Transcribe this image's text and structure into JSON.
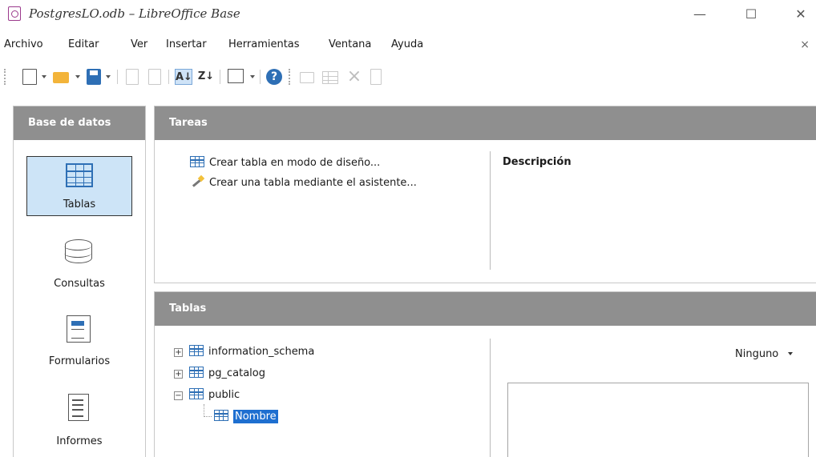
{
  "window": {
    "title": "PostgresLO.odb – LibreOffice Base",
    "minimize": "—",
    "maximize": "☐",
    "close": "✕"
  },
  "menubar": {
    "items": [
      "Archivo",
      "Editar",
      "Ver",
      "Insertar",
      "Herramientas",
      "Ventana",
      "Ayuda"
    ],
    "close": "×"
  },
  "toolbar": {
    "sort_asc": "A↓",
    "sort_desc": "Z↓",
    "help": "?"
  },
  "left_panel": {
    "header": "Base de datos",
    "items": [
      {
        "label": "Tablas",
        "active": true,
        "icon": "table-icon"
      },
      {
        "label": "Consultas",
        "active": false,
        "icon": "database-icon"
      },
      {
        "label": "Formularios",
        "active": false,
        "icon": "form-icon"
      },
      {
        "label": "Informes",
        "active": false,
        "icon": "report-icon"
      }
    ]
  },
  "tasks_panel": {
    "header": "Tareas",
    "tasks": [
      {
        "label": "Crear tabla en modo de diseño...",
        "icon": "table-design-icon"
      },
      {
        "label": "Crear una tabla mediante el asistente...",
        "icon": "wizard-icon"
      }
    ],
    "description_label": "Descripción"
  },
  "tables_panel": {
    "header": "Tablas",
    "tree": [
      {
        "label": "information_schema",
        "expander": "+",
        "expanded": false
      },
      {
        "label": "pg_catalog",
        "expander": "+",
        "expanded": false
      },
      {
        "label": "public",
        "expander": "−",
        "expanded": true
      }
    ],
    "child": {
      "label": "Nombre",
      "selected": true
    },
    "preview_select": "Ninguno"
  },
  "colors": {
    "header_bg": "#8f8f8f",
    "accent": "#2e6fb5",
    "selection": "#1e6fd0",
    "active_nav_bg": "#cde4f7"
  }
}
